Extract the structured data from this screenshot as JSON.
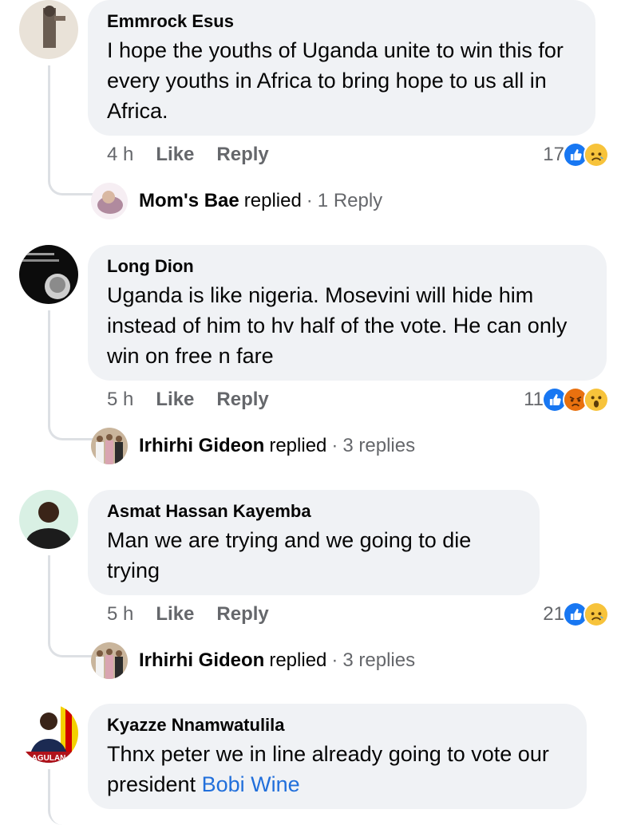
{
  "comments": [
    {
      "author": "Emmrock Esus",
      "text": "I hope the youths of Uganda unite to win this for every youths in Africa to bring hope to us all in Africa.",
      "time": "4 h",
      "like": "Like",
      "reply": "Reply",
      "reaction_count": "17",
      "reactions": [
        "like-icon",
        "sad-icon"
      ],
      "reply_summary": {
        "name": "Mom's Bae",
        "verb": "replied",
        "dot": "·",
        "count": "1 Reply"
      }
    },
    {
      "author": "Long Dion",
      "text": "Uganda is like nigeria. Mosevini will hide him instead of him to hv half of the vote. He can only win on free n fare",
      "time": "5 h",
      "like": "Like",
      "reply": "Reply",
      "reaction_count": "11",
      "reactions": [
        "like-icon",
        "angry-icon",
        "wow-icon"
      ],
      "reply_summary": {
        "name": "Irhirhi Gideon",
        "verb": "replied",
        "dot": "·",
        "count": "3 replies"
      }
    },
    {
      "author": "Asmat Hassan Kayemba",
      "text": "Man we are trying and we going to die trying",
      "time": "5 h",
      "like": "Like",
      "reply": "Reply",
      "reaction_count": "21",
      "reactions": [
        "like-icon",
        "sad-icon"
      ],
      "reply_summary": {
        "name": "Irhirhi Gideon",
        "verb": "replied",
        "dot": "·",
        "count": "3 replies"
      }
    },
    {
      "author": "Kyazze Nnamwatulila",
      "text_before_link": "Thnx peter we in line already going to vote our president ",
      "link_text": "Bobi Wine",
      "avatar_text": "AGULAN"
    }
  ],
  "colors": {
    "bubble": "#f0f2f5",
    "link": "#216fdb",
    "like": "#1877f2",
    "secondary_text": "#65676b"
  }
}
